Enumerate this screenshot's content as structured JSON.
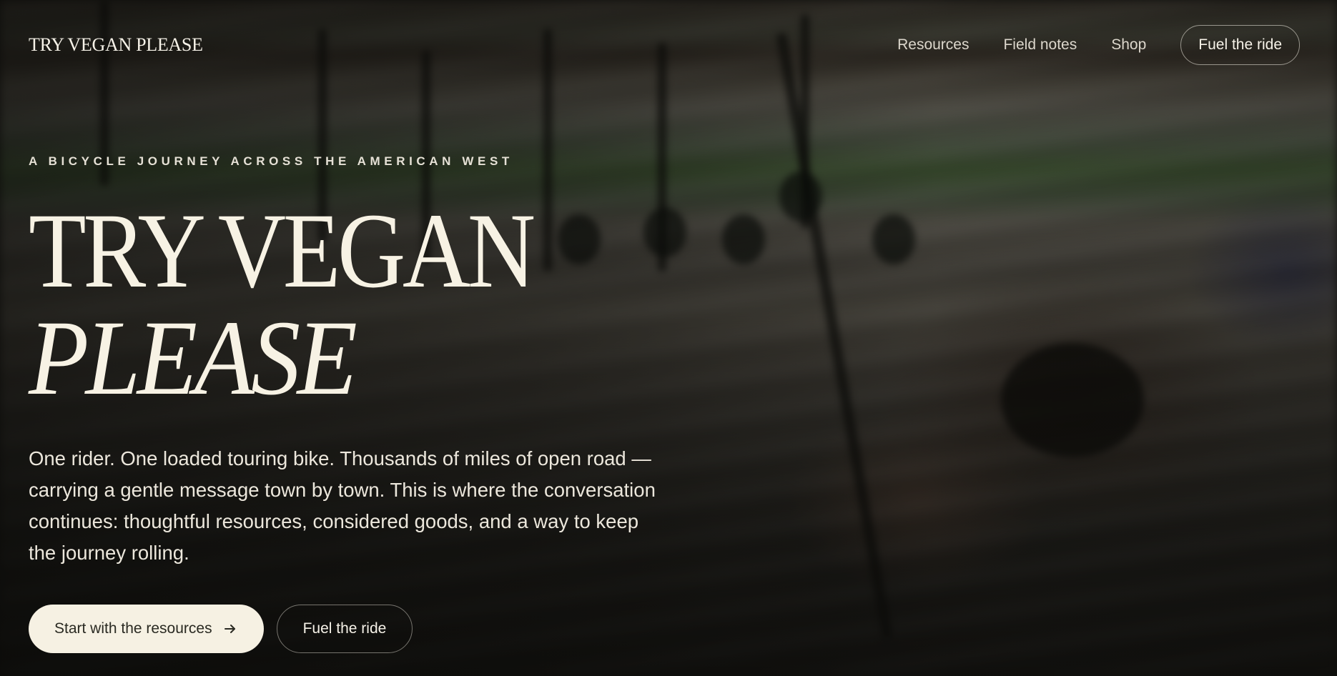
{
  "header": {
    "logo": "TRY VEGAN PLEASE",
    "nav": [
      {
        "label": "Resources"
      },
      {
        "label": "Field notes"
      },
      {
        "label": "Shop"
      }
    ],
    "cta_label": "Fuel the ride"
  },
  "hero": {
    "eyebrow": "A BICYCLE JOURNEY ACROSS THE AMERICAN WEST",
    "headline_line1": "TRY VEGAN",
    "headline_line2": "PLEASE",
    "lede": "One rider. One loaded touring bike. Thousands of miles of open road — carrying a gentle message town by town. This is where the conversation continues: thoughtful resources, considered goods, and a way to keep the journey rolling.",
    "primary_button": "Start with the resources",
    "primary_button_icon": "arrow-right-icon",
    "secondary_button": "Fuel the ride"
  },
  "colors": {
    "text_light": "#f3efe4",
    "button_fill": "#f6f1e3",
    "button_text": "#2a2a22",
    "background_dark": "#1a1a17"
  }
}
